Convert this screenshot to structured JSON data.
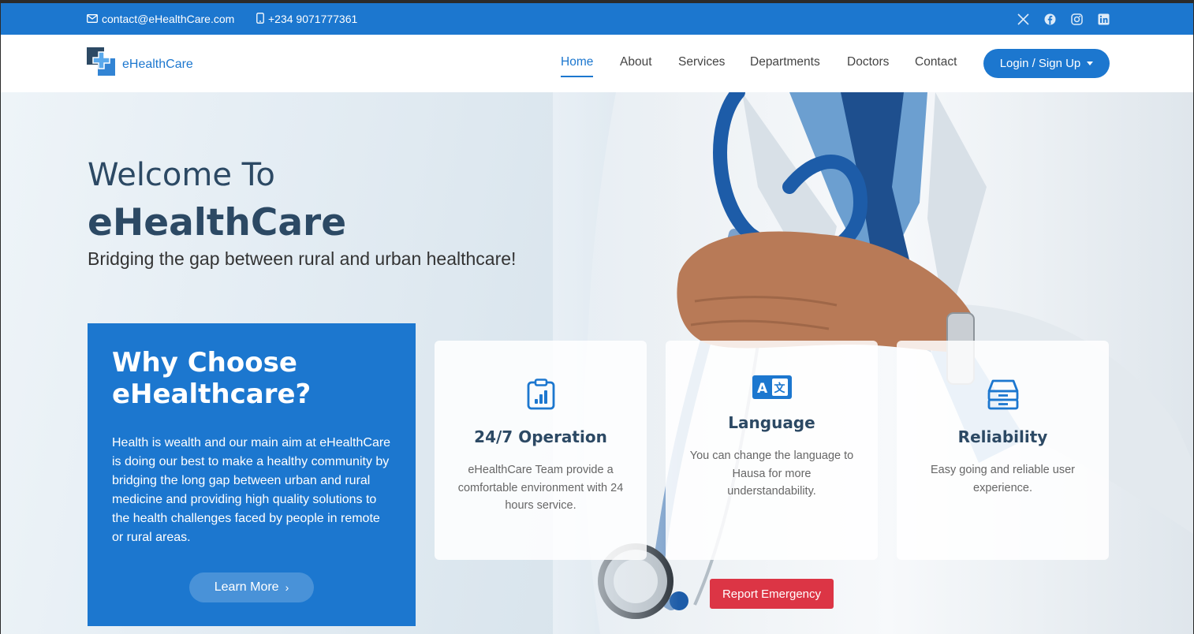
{
  "topbar": {
    "email": "contact@eHealthCare.com",
    "phone": "+234 9071777361",
    "social": [
      "x-icon",
      "facebook-icon",
      "instagram-icon",
      "linkedin-icon"
    ]
  },
  "header": {
    "brand": "eHealthCare",
    "nav": [
      "Home",
      "About",
      "Services",
      "Departments",
      "Doctors",
      "Contact"
    ],
    "active_nav": "Home",
    "login_label": "Login / Sign Up"
  },
  "hero": {
    "welcome": "Welcome To",
    "brand": "eHealthCare",
    "tagline": "Bridging the gap between rural and urban healthcare!"
  },
  "why": {
    "title": "Why Choose eHealthcare?",
    "text": "Health is wealth and our main aim at eHealthCare is doing our best to make a healthy community by bridging the long gap between urban and rural medicine and providing high quality solutions to the health challenges faced by people in remote or rural areas.",
    "button": "Learn More"
  },
  "cards": [
    {
      "icon": "clipboard-chart-icon",
      "title": "24/7 Operation",
      "text": "eHealthCare Team provide a comfortable environment with 24 hours service."
    },
    {
      "icon": "translate-icon",
      "title": "Language",
      "text": "You can change the language to Hausa for more understandability."
    },
    {
      "icon": "inbox-stack-icon",
      "title": "Reliability",
      "text": "Easy going and reliable user experience."
    }
  ],
  "emergency_label": "Report Emergency",
  "colors": {
    "primary": "#1c77cf",
    "heading": "#2c4964",
    "danger": "#dc3545"
  }
}
